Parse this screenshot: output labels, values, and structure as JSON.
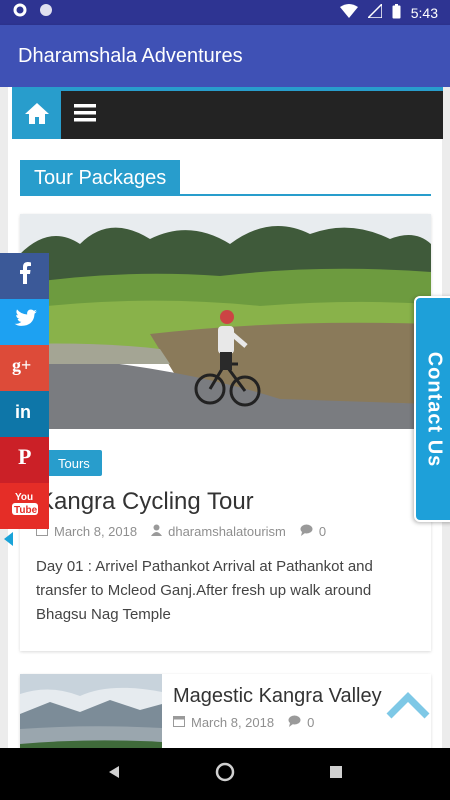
{
  "status_bar": {
    "time": "5:43"
  },
  "app_bar": {
    "title": "Dharamshala Adventures"
  },
  "section": {
    "title": "Tour Packages"
  },
  "post1": {
    "category": "Tours",
    "title": "Kangra Cycling Tour",
    "date": "March 8, 2018",
    "author": "dharamshalatourism",
    "comments": "0",
    "excerpt": "Day 01 :  Arrivel Pathankot Arrival at Pathankot and transfer to Mcleod Ganj.After fresh up walk around Bhagsu Nag Temple"
  },
  "post2": {
    "title": "Magestic Kangra Valley",
    "date": "March 8, 2018",
    "comments": "0"
  },
  "social": [
    {
      "icon": "facebook-icon",
      "glyph": "f",
      "color": "#3b5998"
    },
    {
      "icon": "twitter-icon",
      "glyph": "t",
      "color": "#1da1f2"
    },
    {
      "icon": "google-plus-icon",
      "glyph": "g+",
      "color": "#dd4b39"
    },
    {
      "icon": "linkedin-icon",
      "glyph": "in",
      "color": "#0e76a8"
    },
    {
      "icon": "pinterest-icon",
      "glyph": "P",
      "color": "#cb2027"
    },
    {
      "icon": "youtube-icon",
      "glyph": "You Tube",
      "color": "#e52d27"
    }
  ],
  "contact_tab": {
    "label": "Contact Us"
  },
  "colors": {
    "accent": "#289dcc",
    "app_bar": "#3f51b5",
    "status_bar": "#2e3492"
  }
}
